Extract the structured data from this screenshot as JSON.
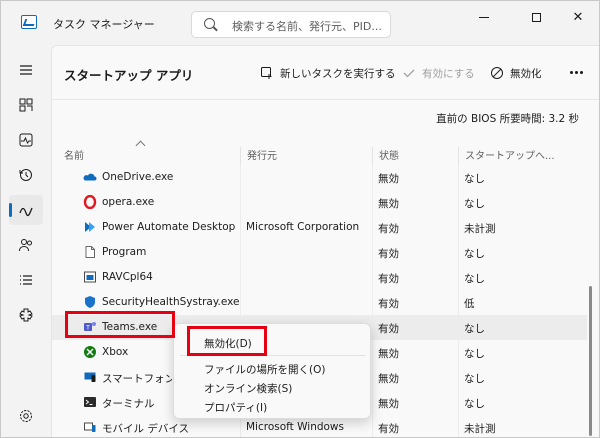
{
  "window": {
    "title": "タスク マネージャー",
    "search_placeholder": "検索する名前、発行元、PID...",
    "controls": {
      "minimize": "minimize-icon",
      "maximize": "maximize-icon",
      "close": "✕"
    }
  },
  "nav": {
    "items": [
      {
        "icon": "hamburger-menu-icon",
        "active": false
      },
      {
        "icon": "processes-icon",
        "active": false
      },
      {
        "icon": "performance-icon",
        "active": false
      },
      {
        "icon": "app-history-icon",
        "active": false
      },
      {
        "icon": "startup-apps-icon",
        "active": true
      },
      {
        "icon": "users-icon",
        "active": false
      },
      {
        "icon": "details-icon",
        "active": false
      },
      {
        "icon": "services-icon",
        "active": false
      },
      {
        "icon": "settings-icon",
        "active": false
      }
    ]
  },
  "toolbar": {
    "page_title": "スタートアップ アプリ",
    "new_task_label": "新しいタスクを実行する",
    "enable_label": "有効にする",
    "disable_label": "無効化",
    "more_icon": "more-options-icon"
  },
  "bios": "直前の BIOS 所要時間:  3.2 秒",
  "table": {
    "headers": [
      "名前",
      "発行元",
      "状態",
      "スタートアップへ..."
    ],
    "rows": [
      {
        "name": "OneDrive.exe",
        "publisher": "",
        "status": "無効",
        "impact": "なし",
        "icon": "onedrive-icon"
      },
      {
        "name": "opera.exe",
        "publisher": "",
        "status": "無効",
        "impact": "なし",
        "icon": "opera-icon"
      },
      {
        "name": "Power Automate Desktop",
        "publisher": "Microsoft Corporation",
        "status": "有効",
        "impact": "未計測",
        "icon": "power-automate-icon"
      },
      {
        "name": "Program",
        "publisher": "",
        "status": "有効",
        "impact": "なし",
        "icon": "file-icon"
      },
      {
        "name": "RAVCpl64",
        "publisher": "",
        "status": "有効",
        "impact": "なし",
        "icon": "app-window-icon"
      },
      {
        "name": "SecurityHealthSystray.exe",
        "publisher": "",
        "status": "有効",
        "impact": "低",
        "icon": "shield-icon"
      },
      {
        "name": "Teams.exe",
        "publisher": "",
        "status": "有効",
        "impact": "なし",
        "icon": "teams-icon"
      },
      {
        "name": "Xbox",
        "publisher": "",
        "status": "無効",
        "impact": "なし",
        "icon": "xbox-icon"
      },
      {
        "name": "スマートフォン連携",
        "publisher": "",
        "status": "無効",
        "impact": "なし",
        "icon": "phone-link-icon"
      },
      {
        "name": "ターミナル",
        "publisher": "",
        "status": "無効",
        "impact": "なし",
        "icon": "terminal-icon"
      },
      {
        "name": "モバイル デバイス",
        "publisher": "Microsoft Windows",
        "status": "有効",
        "impact": "未計測",
        "icon": "mobile-devices-icon"
      }
    ]
  },
  "context_menu": {
    "items": [
      "無効化(D)",
      "ファイルの場所を開く(O)",
      "オンライン検索(S)",
      "プロパティ(I)"
    ]
  },
  "colors": {
    "accent": "#0f6cbd",
    "highlight": "#e60012"
  }
}
